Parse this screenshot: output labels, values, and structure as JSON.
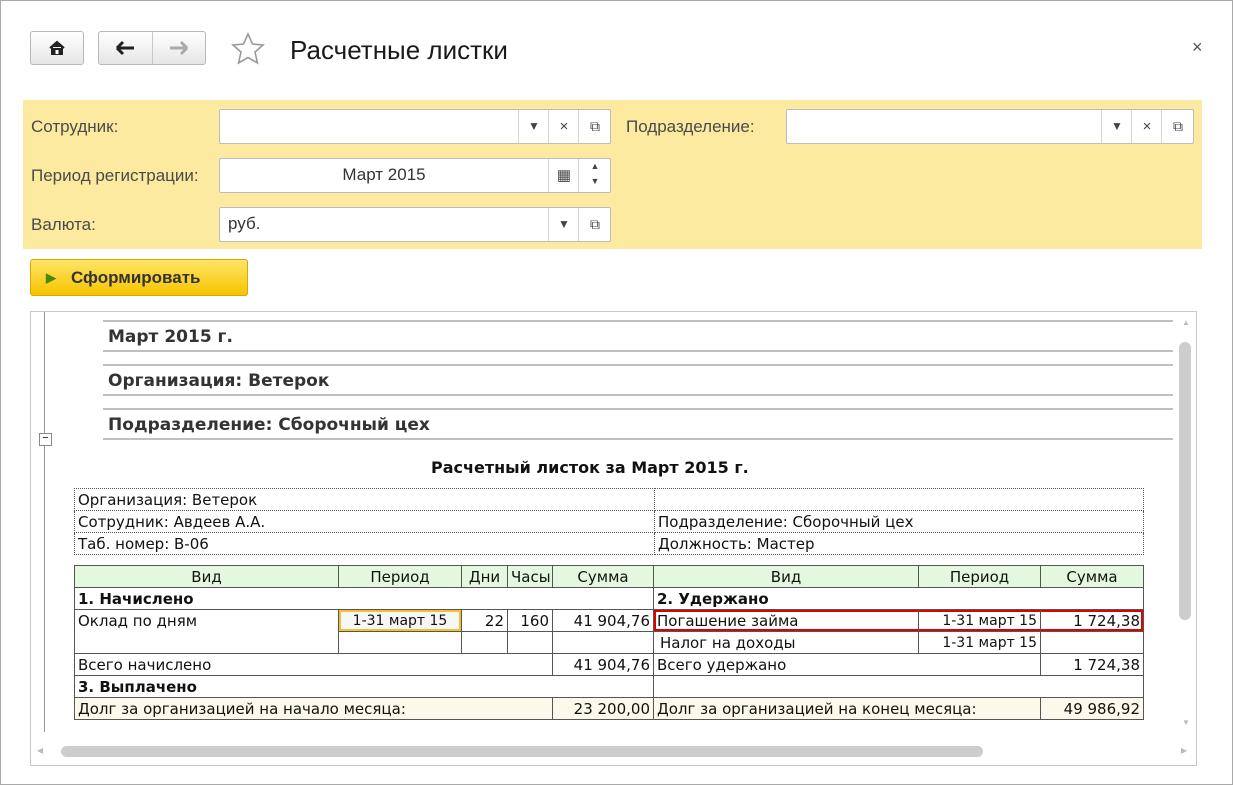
{
  "window": {
    "title": "Расчетные листки",
    "close_glyph": "×"
  },
  "nav": {
    "home_icon": "home-icon",
    "back_icon": "arrow-left-icon",
    "forward_icon": "arrow-right-icon",
    "favorite_icon": "star-icon"
  },
  "filters": {
    "employee_label": "Сотрудник:",
    "employee_value": "",
    "department_label": "Подразделение:",
    "department_value": "",
    "period_label": "Период регистрации:",
    "period_value": "Март 2015",
    "currency_label": "Валюта:",
    "currency_value": "руб."
  },
  "actions": {
    "generate_label": "Сформировать"
  },
  "report": {
    "group_period": "Март 2015 г.",
    "group_org": "Организация: Ветерок",
    "group_dept": "Подразделение: Сборочный цех",
    "title": "Расчетный листок за Март 2015 г.",
    "info": {
      "org": "Организация: Ветерок",
      "employee": "Сотрудник: Авдеев А.А.",
      "dept": "Подразделение: Сборочный цех",
      "tab_no": "Таб. номер: В-06",
      "position": "Должность: Мастер"
    },
    "headers": {
      "kind": "Вид",
      "period": "Период",
      "days": "Дни",
      "hours": "Часы",
      "sum": "Сумма",
      "kind2": "Вид",
      "period2": "Период",
      "sum2": "Сумма"
    },
    "accrued_title": "1. Начислено",
    "withheld_title": "2. Удержано",
    "accrued_row": {
      "kind": "Оклад по дням",
      "period": "1-31 март 15",
      "days": "22",
      "hours": "160",
      "sum": "41 904,76"
    },
    "withheld_rows": [
      {
        "kind": "Погашение займа",
        "period": "1-31 март 15",
        "sum": "1 724,38"
      },
      {
        "kind": "Налог на доходы",
        "period": "1-31 март 15",
        "sum": ""
      }
    ],
    "total_accrued_label": "Всего начислено",
    "total_accrued": "41 904,76",
    "total_withheld_label": "Всего удержано",
    "total_withheld": "1 724,38",
    "paid_title": "3. Выплачено",
    "debt_start_label": "Долг за организацией на начало месяца:",
    "debt_start": "23 200,00",
    "debt_end_label": "Долг за организацией на конец месяца:",
    "debt_end": "49 986,92"
  }
}
